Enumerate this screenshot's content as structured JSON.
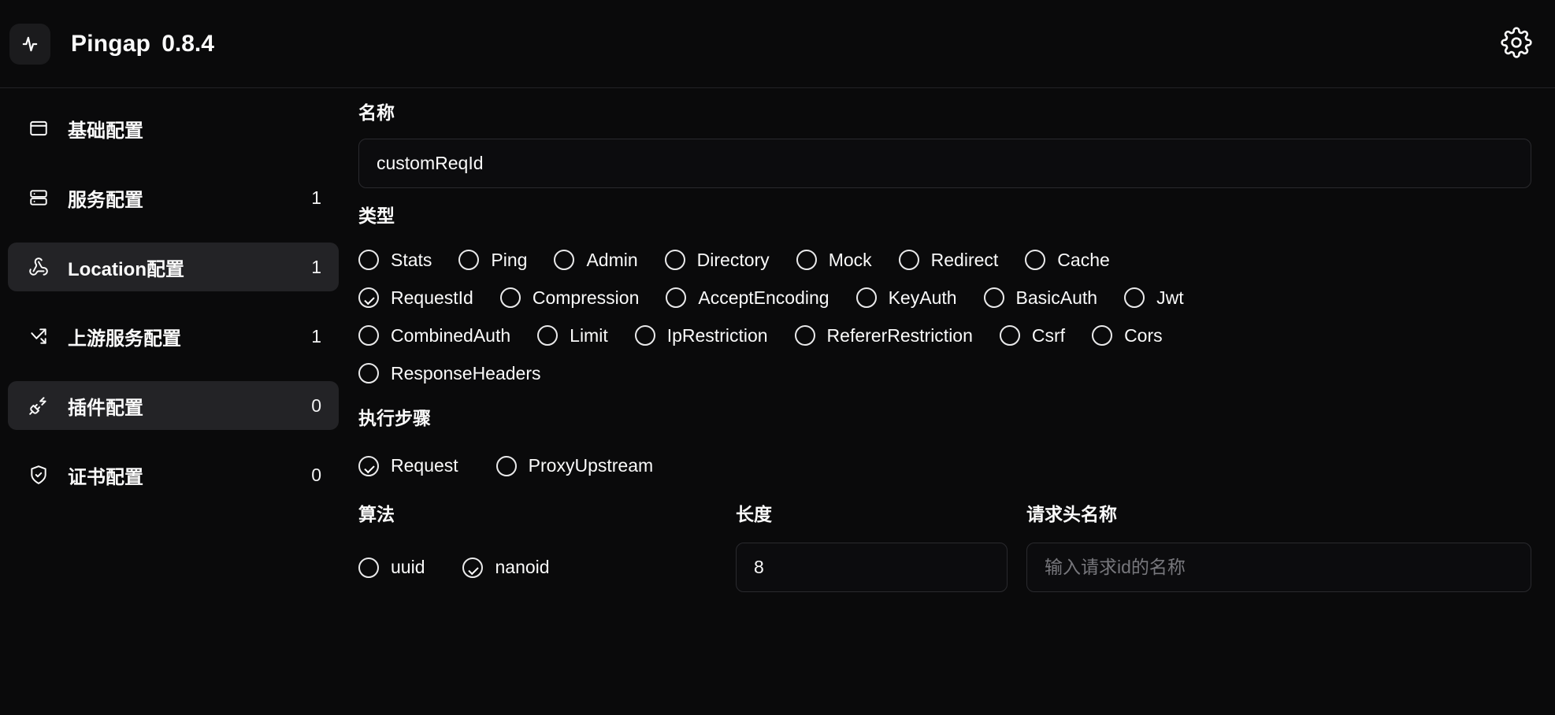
{
  "header": {
    "logo_icon": "activity-pulse-icon",
    "title": "Pingap",
    "version": "0.8.4",
    "settings_icon": "gear-icon"
  },
  "sidebar": {
    "items": [
      {
        "icon": "window-panel-icon",
        "label": "基础配置",
        "badge": "",
        "active": false
      },
      {
        "icon": "server-rack-icon",
        "label": "服务配置",
        "badge": "1",
        "active": false
      },
      {
        "icon": "webhook-icon",
        "label": "Location配置",
        "badge": "1",
        "active": true
      },
      {
        "icon": "share-network-icon",
        "label": "上游服务配置",
        "badge": "1",
        "active": false
      },
      {
        "icon": "plug-zap-icon",
        "label": "插件配置",
        "badge": "0",
        "active": true
      },
      {
        "icon": "shield-check-icon",
        "label": "证书配置",
        "badge": "0",
        "active": false
      }
    ]
  },
  "main": {
    "name_section": {
      "label": "名称",
      "value": "customReqId",
      "placeholder": ""
    },
    "type_section": {
      "label": "类型",
      "rows": [
        [
          {
            "label": "Stats",
            "checked": false
          },
          {
            "label": "Ping",
            "checked": false
          },
          {
            "label": "Admin",
            "checked": false
          },
          {
            "label": "Directory",
            "checked": false
          },
          {
            "label": "Mock",
            "checked": false
          },
          {
            "label": "Redirect",
            "checked": false
          },
          {
            "label": "Cache",
            "checked": false
          }
        ],
        [
          {
            "label": "RequestId",
            "checked": true
          },
          {
            "label": "Compression",
            "checked": false
          },
          {
            "label": "AcceptEncoding",
            "checked": false
          },
          {
            "label": "KeyAuth",
            "checked": false
          },
          {
            "label": "BasicAuth",
            "checked": false
          },
          {
            "label": "Jwt",
            "checked": false
          }
        ],
        [
          {
            "label": "CombinedAuth",
            "checked": false
          },
          {
            "label": "Limit",
            "checked": false
          },
          {
            "label": "IpRestriction",
            "checked": false
          },
          {
            "label": "RefererRestriction",
            "checked": false
          },
          {
            "label": "Csrf",
            "checked": false
          },
          {
            "label": "Cors",
            "checked": false
          }
        ],
        [
          {
            "label": "ResponseHeaders",
            "checked": false
          }
        ]
      ]
    },
    "step_section": {
      "label": "执行步骤",
      "options": [
        {
          "label": "Request",
          "checked": true
        },
        {
          "label": "ProxyUpstream",
          "checked": false
        }
      ]
    },
    "algorithm_section": {
      "label": "算法",
      "options": [
        {
          "label": "uuid",
          "checked": false
        },
        {
          "label": "nanoid",
          "checked": true
        }
      ]
    },
    "length_section": {
      "label": "长度",
      "value": "8",
      "placeholder": ""
    },
    "header_name_section": {
      "label": "请求头名称",
      "value": "",
      "placeholder": "输入请求id的名称"
    }
  },
  "colors": {
    "background": "#0a0a0b",
    "surface_active": "#232326",
    "border": "#2a2a2e",
    "text_primary": "#fafafa",
    "text_muted": "#77777c"
  }
}
